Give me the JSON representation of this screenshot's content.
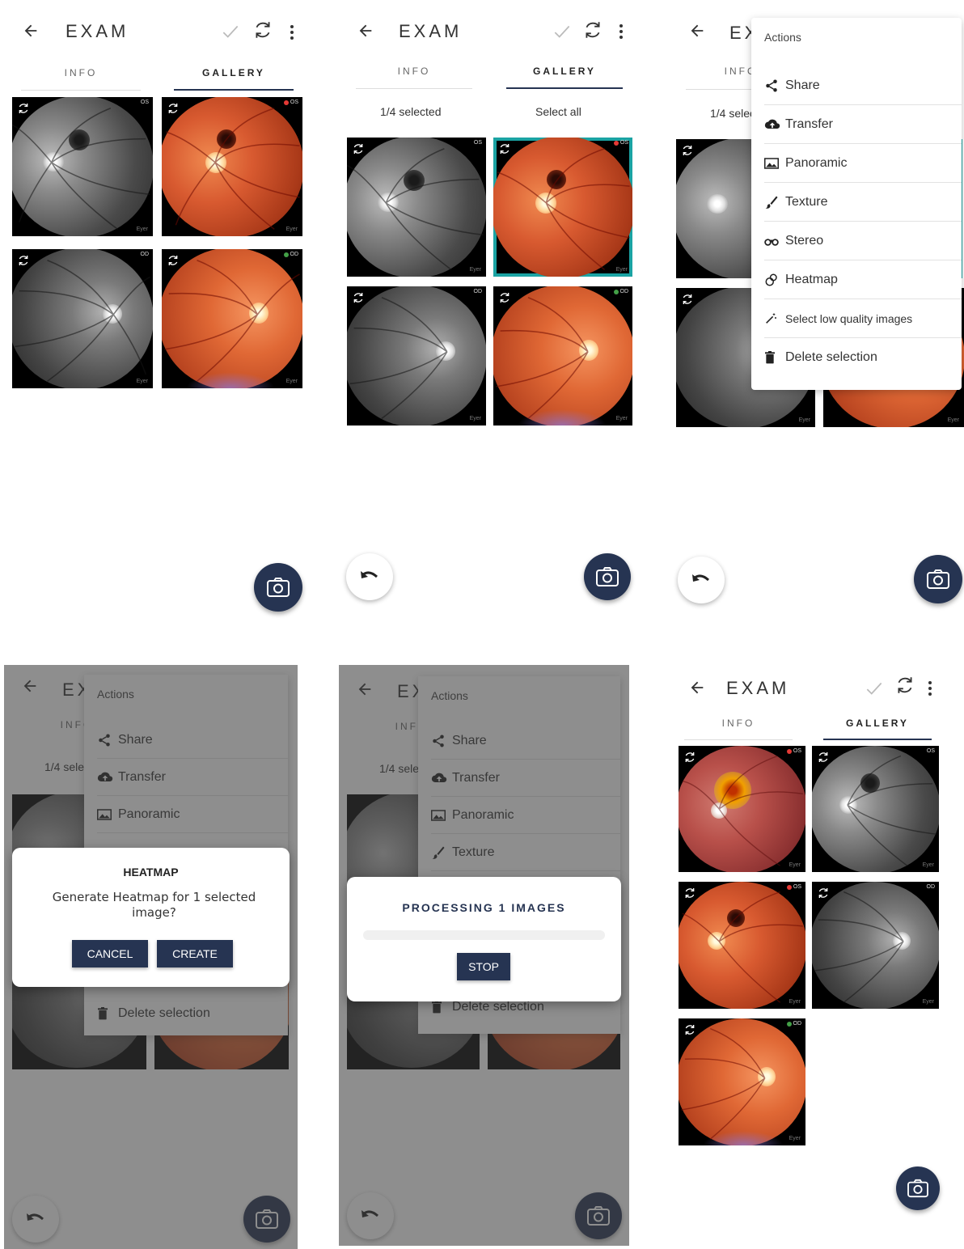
{
  "header": {
    "title": "EXAM"
  },
  "tabs": {
    "info": "INFO",
    "gallery": "GALLERY"
  },
  "selection": {
    "count_label": "1/4 selected",
    "select_all": "Select all"
  },
  "eye_labels": {
    "os": "OS",
    "od": "OD"
  },
  "watermark": "Eyer",
  "actions_menu": {
    "title": "Actions",
    "items": [
      {
        "label": "Share",
        "icon": "share-icon"
      },
      {
        "label": "Transfer",
        "icon": "cloud-upload-icon"
      },
      {
        "label": "Panoramic",
        "icon": "panorama-icon"
      },
      {
        "label": "Texture",
        "icon": "brush-icon"
      },
      {
        "label": "Stereo",
        "icon": "binoculars-icon"
      },
      {
        "label": "Heatmap",
        "icon": "heatmap-icon"
      },
      {
        "label": "Select low quality images",
        "icon": "magic-wand-icon"
      },
      {
        "label": "Delete selection",
        "icon": "trash-icon"
      }
    ]
  },
  "heatmap_dialog": {
    "title": "HEATMAP",
    "message": "Generate Heatmap for 1 selected image?",
    "cancel": "CANCEL",
    "create": "CREATE"
  },
  "processing_dialog": {
    "title": "PROCESSING 1 IMAGES",
    "stop": "STOP",
    "progress": 0
  },
  "colors": {
    "primary": "#263452",
    "selected_border": "#1aa3a3",
    "status_red": "#e53935",
    "status_green": "#43a047"
  }
}
